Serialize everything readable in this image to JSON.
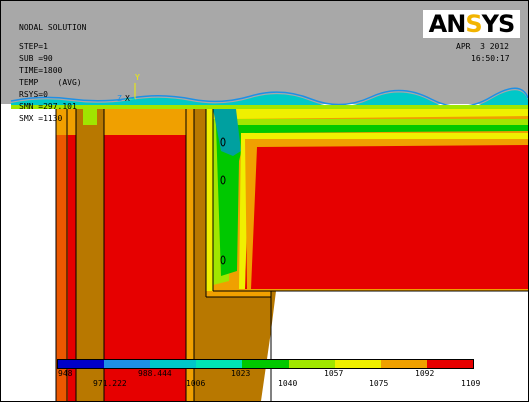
{
  "header": {
    "title": "NODAL SOLUTION",
    "step": "STEP=1",
    "sub": "SUB =90",
    "time": "TIME=1800",
    "temp": "TEMP    (AVG)",
    "rsys": "RSYS=0",
    "smn": "SMN =297.101",
    "smx": "SMX =1130",
    "date": "APR  3 2012",
    "clock": "16:50:17"
  },
  "logo": {
    "part1": "AN",
    "part2": "S",
    "part3": "YS"
  },
  "triad": {
    "y_label": "Y",
    "x_label": "X",
    "z_label": "Z"
  },
  "legend": {
    "colors": [
      "#0000c8",
      "#1e90e6",
      "#00c8c8",
      "#00e6b4",
      "#00c800",
      "#a0e600",
      "#f0f000",
      "#f0a000",
      "#e60000"
    ],
    "labels": [
      "948",
      "971.222",
      "988.444",
      "1006",
      "1023",
      "1040",
      "1057",
      "1075",
      "1092",
      "1109"
    ]
  }
}
